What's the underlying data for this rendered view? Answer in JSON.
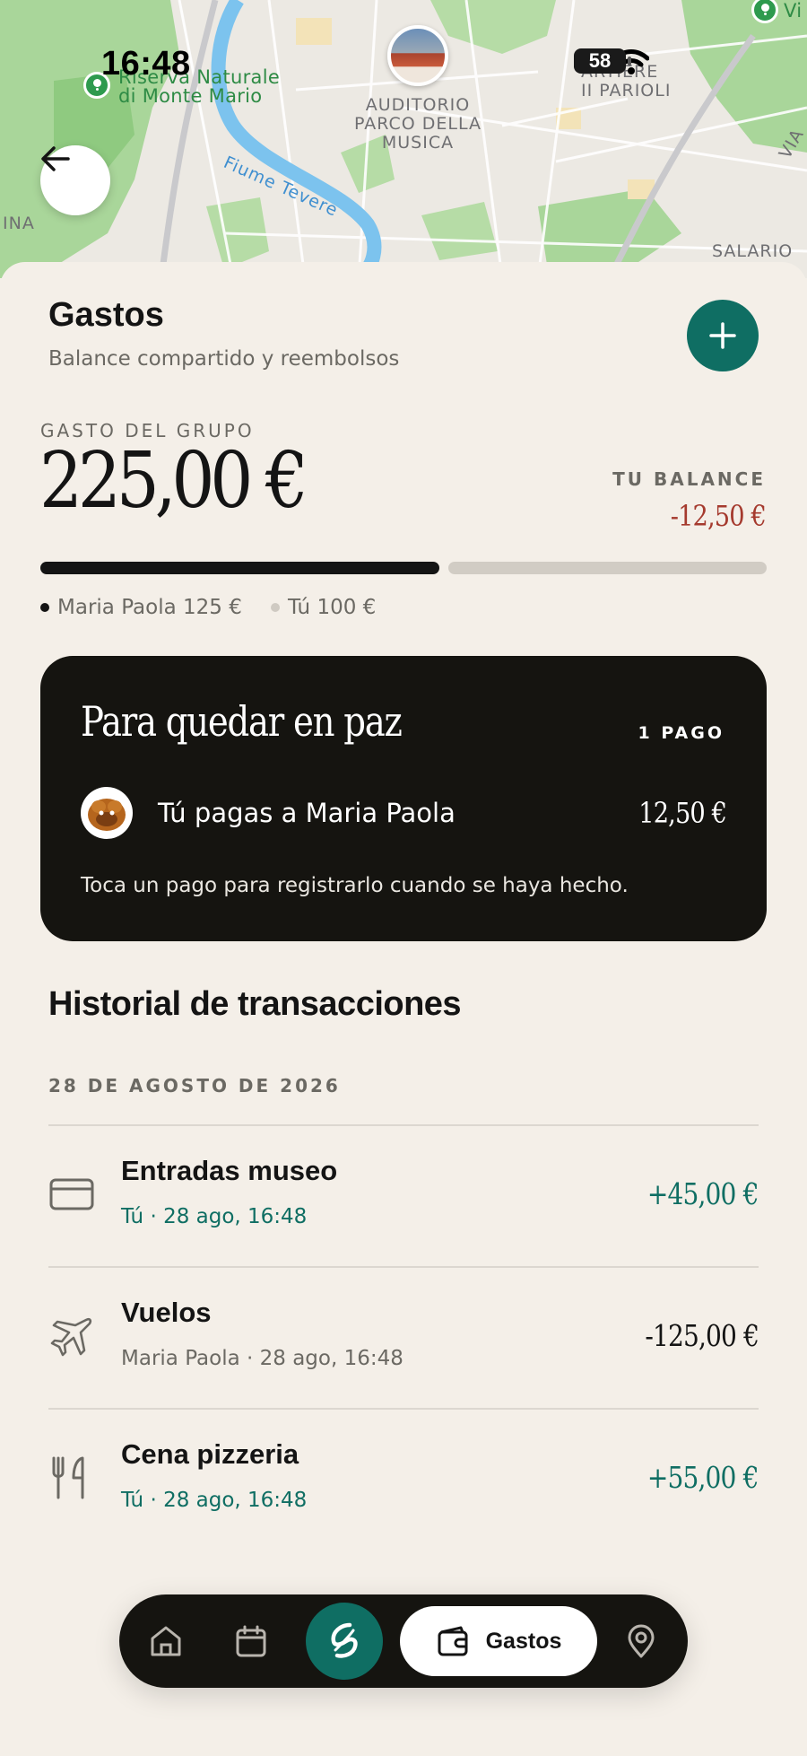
{
  "status_bar": {
    "time": "16:48",
    "battery": "58"
  },
  "map": {
    "labels": {
      "park": "Riserva Naturale\ndi Monte Mario",
      "venue": "AUDITORIO\nPARCO DELLA\nMUSICA",
      "district": "ARTIERE\nII PARIOLI",
      "river": "Fiume Tevere",
      "west": "INA",
      "east": "SALARIO",
      "corner_right": "VIA",
      "corner_top": "Vi"
    }
  },
  "header": {
    "title": "Gastos",
    "subtitle": "Balance compartido y reembolsos"
  },
  "summary": {
    "group_label": "GASTO DEL GRUPO",
    "group_total": "225,00 €",
    "balance_label": "TU BALANCE",
    "balance_value": "-12,50 €",
    "shares": [
      {
        "name": "Maria Paola",
        "amount": "125 €",
        "label": "Maria Paola 125 €",
        "fraction": 0.556,
        "color": "#141414"
      },
      {
        "name": "Tú",
        "amount": "100 €",
        "label": "Tú 100 €",
        "fraction": 0.444,
        "color": "#d1ccc4"
      }
    ]
  },
  "settle": {
    "title": "Para quedar en paz",
    "count": "1 PAGO",
    "payment": {
      "text": "Tú pagas a Maria Paola",
      "amount": "12,50 €"
    },
    "hint": "Toca un pago para registrarlo cuando se haya hecho."
  },
  "history": {
    "title": "Historial de transacciones",
    "date": "28 DE AGOSTO DE 2026",
    "transactions": [
      {
        "icon": "card-icon",
        "name": "Entradas museo",
        "payer": "Tú",
        "meta": "Tú · 28 ago, 16:48",
        "amount": "+45,00 €",
        "sign": "pos"
      },
      {
        "icon": "plane-icon",
        "name": "Vuelos",
        "payer": "Maria Paola",
        "meta": "Maria Paola · 28 ago, 16:48",
        "amount": "-125,00 €",
        "sign": "neg"
      },
      {
        "icon": "fork-knife-icon",
        "name": "Cena pizzeria",
        "payer": "Tú",
        "meta": "Tú · 28 ago, 16:48",
        "amount": "+55,00 €",
        "sign": "pos"
      }
    ]
  },
  "nav": {
    "items": [
      "home-icon",
      "calendar-icon",
      "app-logo-icon",
      "wallet-icon",
      "location-pin-icon"
    ],
    "active_label": "Gastos"
  },
  "colors": {
    "accent": "#0f6e63",
    "negative": "#a53a2e",
    "background": "#f4efe8",
    "card": "#151410"
  }
}
